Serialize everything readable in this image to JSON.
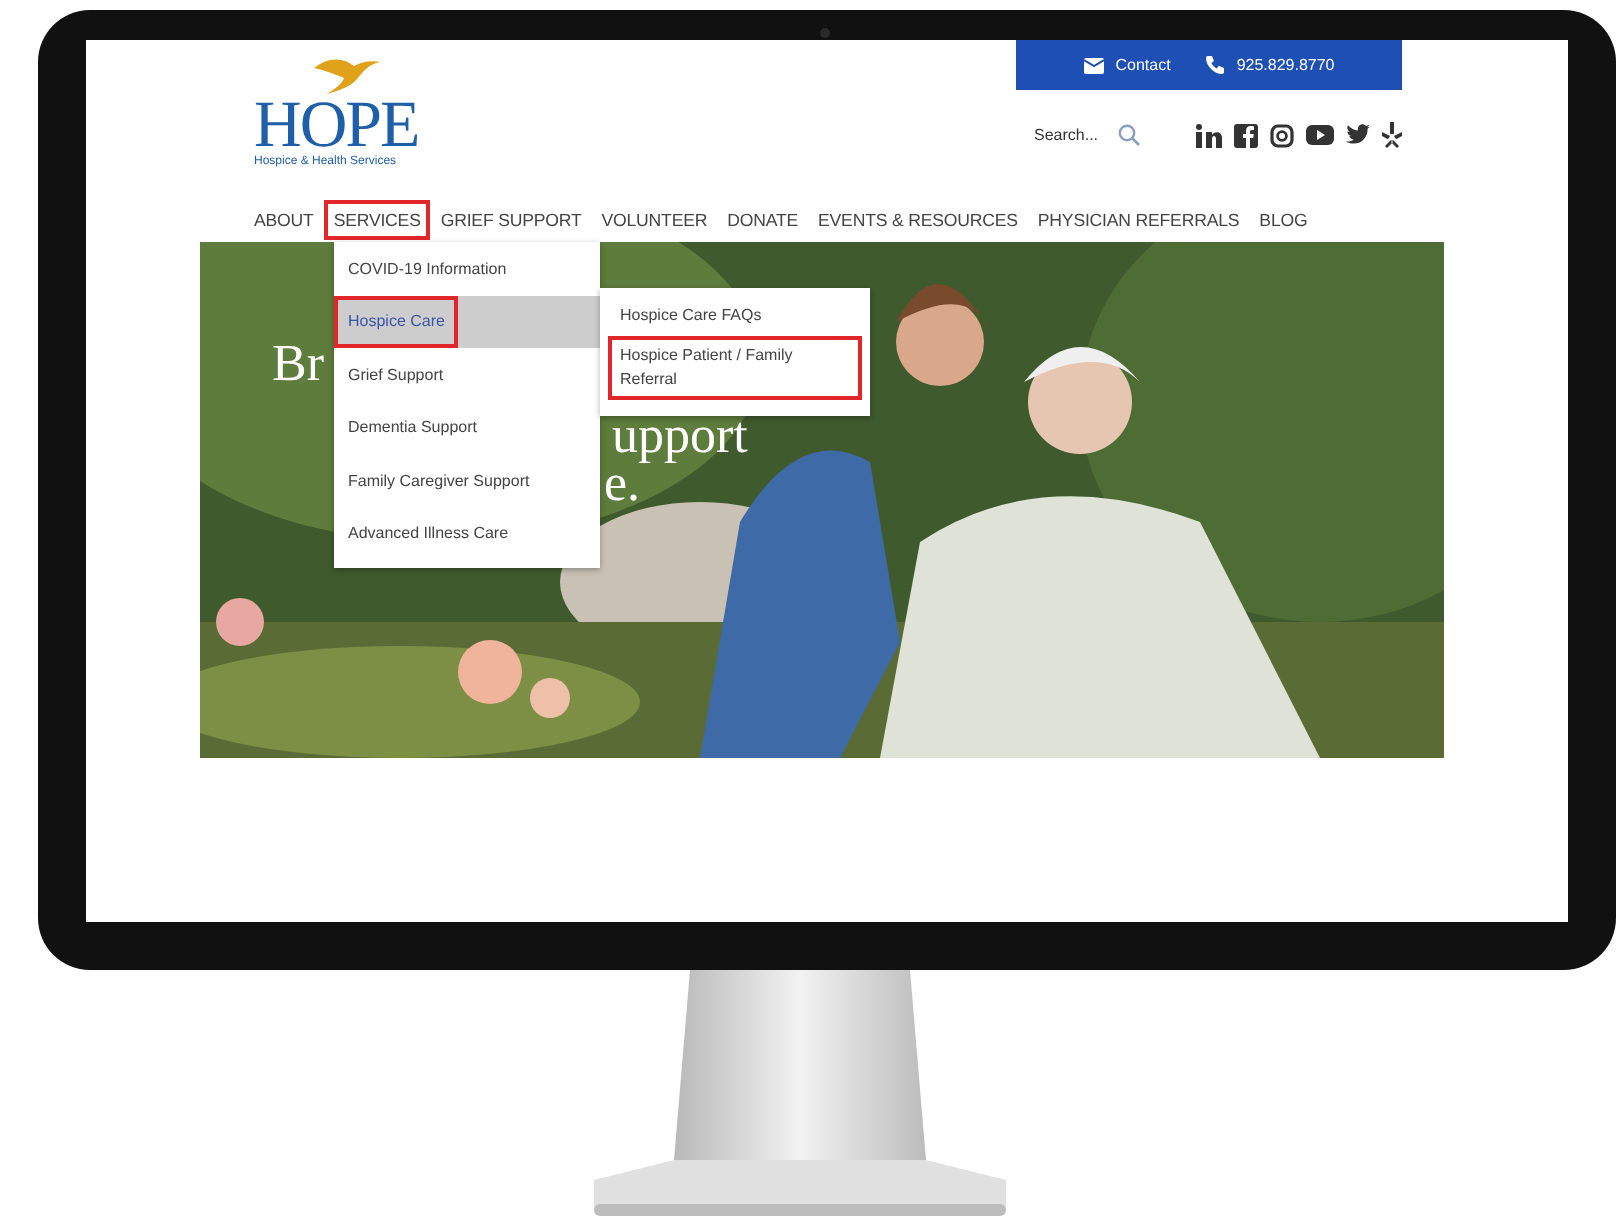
{
  "top_bar": {
    "contact": "Contact",
    "phone": "925.829.8770"
  },
  "logo": {
    "name": "HOPE",
    "tagline": "Hospice & Health Services"
  },
  "search": {
    "placeholder": "Search..."
  },
  "social": [
    {
      "kind": "linkedin"
    },
    {
      "kind": "facebook"
    },
    {
      "kind": "instagram"
    },
    {
      "kind": "youtube"
    },
    {
      "kind": "twitter"
    },
    {
      "kind": "yelp"
    }
  ],
  "nav": [
    {
      "label": "ABOUT",
      "highlighted": false
    },
    {
      "label": "SERVICES",
      "highlighted": true
    },
    {
      "label": "GRIEF SUPPORT",
      "highlighted": false
    },
    {
      "label": "VOLUNTEER",
      "highlighted": false
    },
    {
      "label": "DONATE",
      "highlighted": false
    },
    {
      "label": "EVENTS & RESOURCES",
      "highlighted": false
    },
    {
      "label": "PHYSICIAN REFERRALS",
      "highlighted": false
    },
    {
      "label": "BLOG",
      "highlighted": false
    }
  ],
  "services_menu": [
    {
      "label": "COVID-19 Information",
      "selected": false,
      "highlighted": false
    },
    {
      "label": "Hospice Care",
      "selected": true,
      "highlighted": true
    },
    {
      "label": "Grief Support",
      "selected": false,
      "highlighted": false
    },
    {
      "label": "Dementia Support",
      "selected": false,
      "highlighted": false
    },
    {
      "label": "Family Caregiver Support",
      "selected": false,
      "highlighted": false
    },
    {
      "label": "Advanced Illness Care",
      "selected": false,
      "highlighted": false
    }
  ],
  "hospice_submenu": [
    {
      "label": "Hospice Care FAQs",
      "highlighted": false
    },
    {
      "label": "Hospice Patient / Family Referral",
      "highlighted": true
    }
  ],
  "hero": {
    "heading_fragments": [
      "Br",
      "upport",
      "e."
    ]
  }
}
